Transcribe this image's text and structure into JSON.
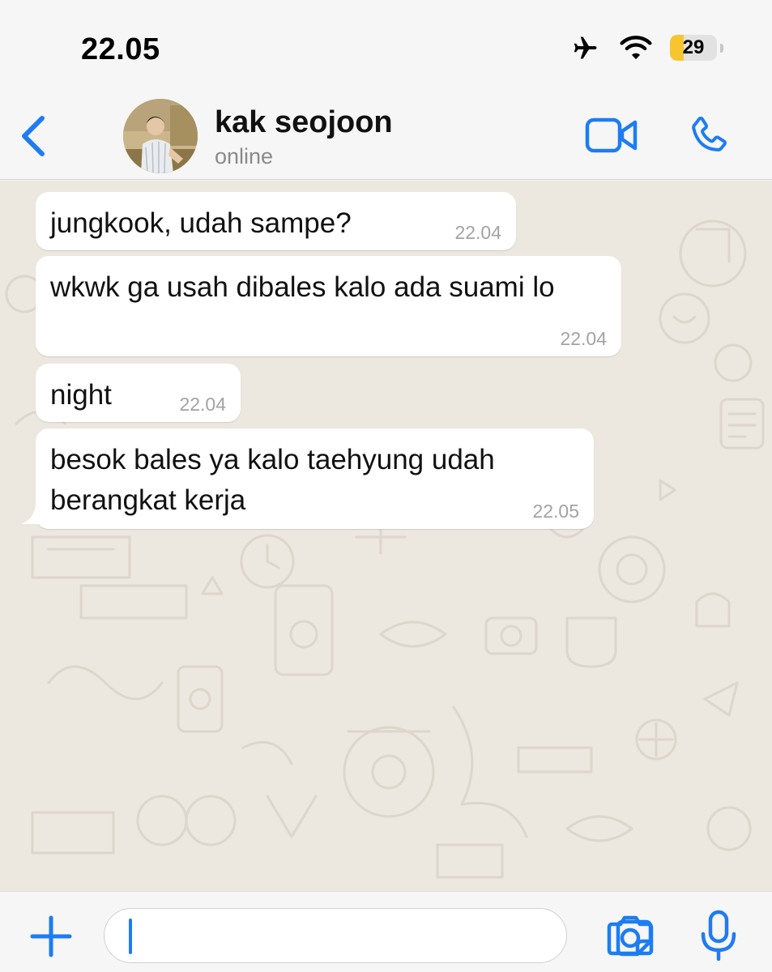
{
  "status_bar": {
    "time": "22.05",
    "battery_level": "29",
    "battery_percent": 29,
    "icons": [
      "airplane-icon",
      "wifi-icon",
      "battery-icon"
    ],
    "battery_color": "#f7c52f"
  },
  "header": {
    "contact_name": "kak seojoon",
    "contact_status": "online",
    "accent_color": "#1e7cf2",
    "icons": [
      "chevron-left-icon",
      "video-camera-icon",
      "phone-icon"
    ]
  },
  "messages": [
    {
      "text": "jungkook, udah sampe?",
      "time": "22.04",
      "direction": "incoming"
    },
    {
      "text": "wkwk ga usah dibales kalo ada suami lo",
      "time": "22.04",
      "direction": "incoming"
    },
    {
      "text": "night",
      "time": "22.04",
      "direction": "incoming"
    },
    {
      "text": "besok bales ya kalo taehyung udah berangkat kerja",
      "time": "22.05",
      "direction": "incoming"
    }
  ],
  "input_bar": {
    "message_value": "",
    "icons": [
      "plus-icon",
      "sticker-icon",
      "camera-icon",
      "microphone-icon"
    ]
  }
}
